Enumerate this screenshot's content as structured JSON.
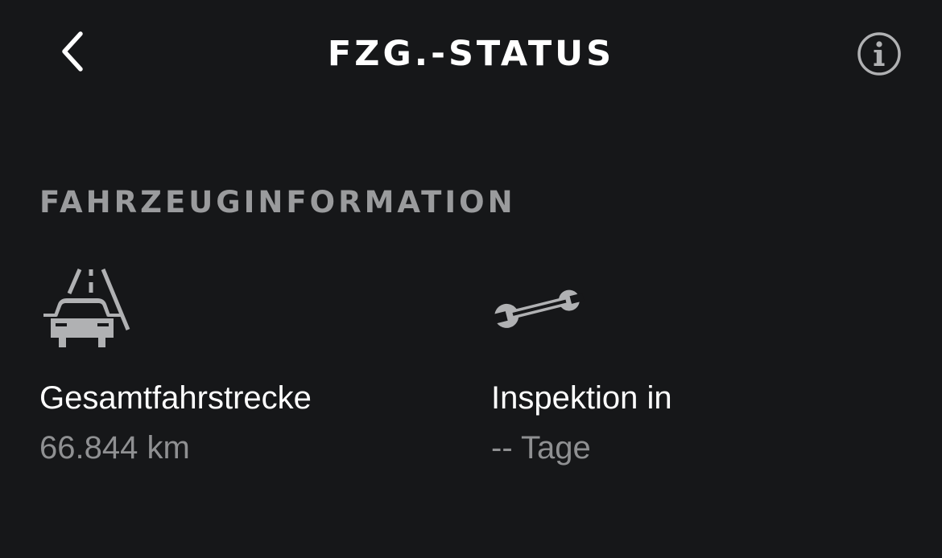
{
  "header": {
    "title": "FZG.-STATUS",
    "back_icon": "chevron-left-icon",
    "info_icon": "info-circle-icon"
  },
  "section": {
    "title": "FAHRZEUGINFORMATION"
  },
  "tiles": [
    {
      "icon": "road-car-icon",
      "label": "Gesamtfahrstrecke",
      "value": "66.844 km"
    },
    {
      "icon": "wrench-icon",
      "label": "Inspektion in",
      "value": "-- Tage"
    }
  ],
  "colors": {
    "background": "#161719",
    "primary_text": "#ffffff",
    "secondary_text": "#8f9092",
    "icon": "#b0b1b3"
  }
}
